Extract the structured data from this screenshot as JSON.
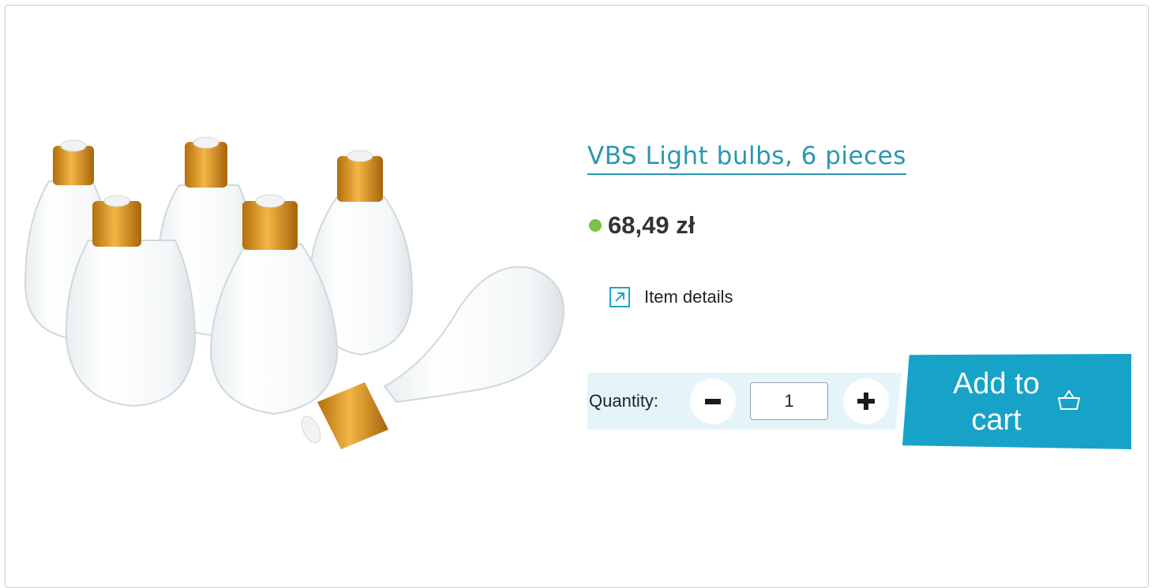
{
  "product": {
    "title": "VBS Light bulbs, 6 pieces",
    "price": "68,49 zł",
    "stock_color": "#7cc142",
    "image_icon": "light-bulbs-image"
  },
  "actions": {
    "details_label": "Item details",
    "details_icon": "external-link-icon",
    "quantity_label": "Quantity:",
    "quantity_value": "1",
    "add_to_cart_label": "Add to cart",
    "cart_icon": "basket-icon"
  },
  "colors": {
    "accent": "#17a3c7",
    "title": "#2a97b0",
    "qty_bar": "#e5f4f9"
  }
}
